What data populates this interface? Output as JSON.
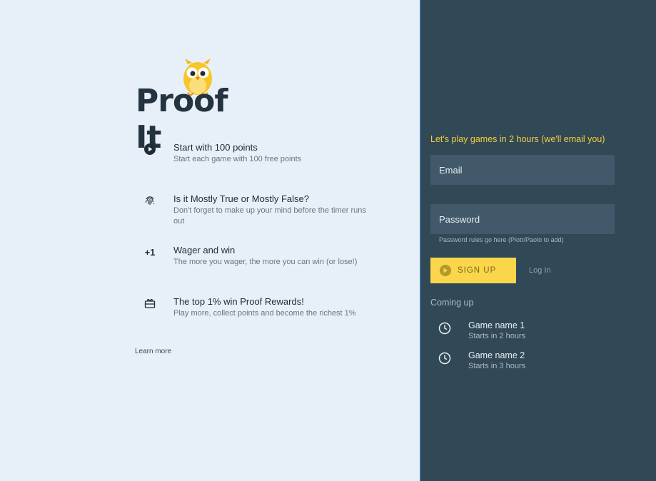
{
  "brand": {
    "name": "Proof It"
  },
  "features": [
    {
      "icon": "play-circle-icon",
      "title": "Start with 100 points",
      "desc": "Start each game with 100 free points"
    },
    {
      "icon": "fingerprint-icon",
      "title": "Is it Mostly True or Mostly False?",
      "desc": "Don't forget to make up your mind before the timer runs out"
    },
    {
      "icon": "plus-one-icon",
      "icon_text": "+1",
      "title": "Wager and win",
      "desc": "The more you wager, the more you can win (or lose!)"
    },
    {
      "icon": "gift-card-icon",
      "title": "The top 1% win Proof Rewards!",
      "desc": "Play more, collect points and become the richest 1%"
    }
  ],
  "learn_more": "Learn more",
  "signup_form": {
    "tagline": "Let's play games in 2 hours (we'll email you)",
    "email_placeholder": "Email",
    "password_placeholder": "Password",
    "password_hint": "Password rules go here (Piotr/Paolo to add)",
    "signup_label": "SIGN UP",
    "login_label": "Log In"
  },
  "coming_up": {
    "heading": "Coming up",
    "games": [
      {
        "name": "Game name 1",
        "starts": "Starts in 2 hours"
      },
      {
        "name": "Game name 2",
        "starts": "Starts in 3 hours"
      }
    ]
  },
  "colors": {
    "left_bg": "#e7eff8",
    "right_bg": "#314856",
    "accent_yellow": "#fbd64a",
    "field_bg": "#41596a"
  }
}
